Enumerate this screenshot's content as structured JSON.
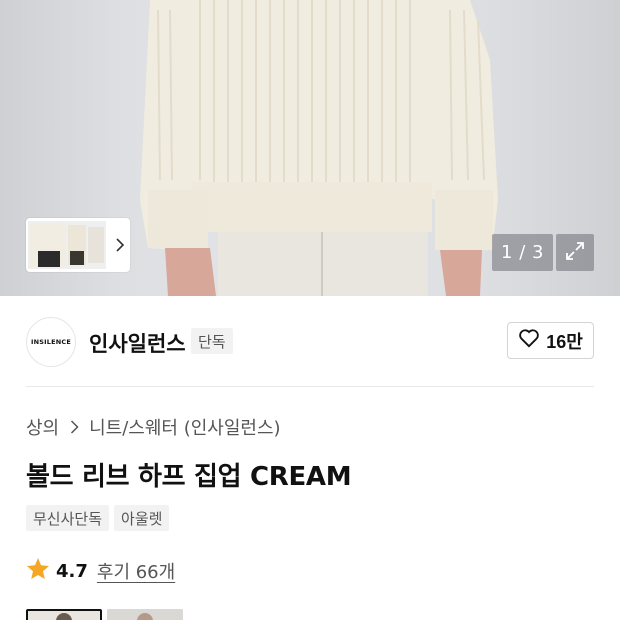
{
  "gallery": {
    "counter": "1 / 3",
    "thumbnail_nav_icon": "chevron-right-icon",
    "expand_icon": "expand-icon"
  },
  "brand": {
    "logo_text": "INSILENCE",
    "name": "인사일런스",
    "exclusive_label": "단독",
    "like_icon": "heart-icon",
    "like_count": "16만"
  },
  "breadcrumb": {
    "items": [
      "상의",
      "니트/스웨터 (인사일런스)"
    ],
    "separator_icon": "chevron-right-icon"
  },
  "product": {
    "title": "볼드 리브 하프 집업 CREAM",
    "tags": [
      "무신사단독",
      "아울렛"
    ]
  },
  "rating": {
    "icon": "star-icon",
    "value": "4.7",
    "review_link": "후기 66개",
    "star_color": "#F5A623"
  }
}
